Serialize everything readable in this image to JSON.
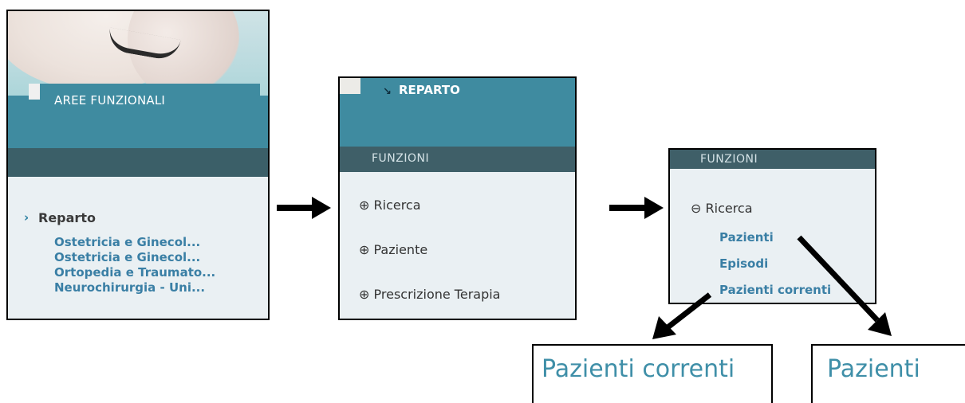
{
  "panel1": {
    "header_title": "AREE FUNZIONALI",
    "section_label": "Reparto",
    "chevron": "›",
    "links": [
      "Ostetricia e Ginecol...",
      "Ostetricia e Ginecol...",
      "Ortopedia e Traumato...",
      "Neurochirurgia - Uni..."
    ]
  },
  "panel2": {
    "header_title": "REPARTO",
    "header_icon": "↘",
    "section_title": "FUNZIONI",
    "items": [
      {
        "icon": "⊕",
        "label": "Ricerca"
      },
      {
        "icon": "⊕",
        "label": "Paziente"
      },
      {
        "icon": "⊕",
        "label": "Prescrizione Terapia"
      }
    ]
  },
  "panel3": {
    "section_title": "FUNZIONI",
    "item": {
      "icon": "⊖",
      "label": "Ricerca"
    },
    "subitems": [
      "Pazienti",
      "Episodi",
      "Pazienti correnti"
    ]
  },
  "zoom": {
    "left_text": "Pazienti correnti",
    "right_text": "Pazienti"
  },
  "colors": {
    "teal": "#3f8ba0",
    "dark_bar": "#3f5f68",
    "panel_bg": "#eaf0f3",
    "link": "#3a7fa5"
  }
}
